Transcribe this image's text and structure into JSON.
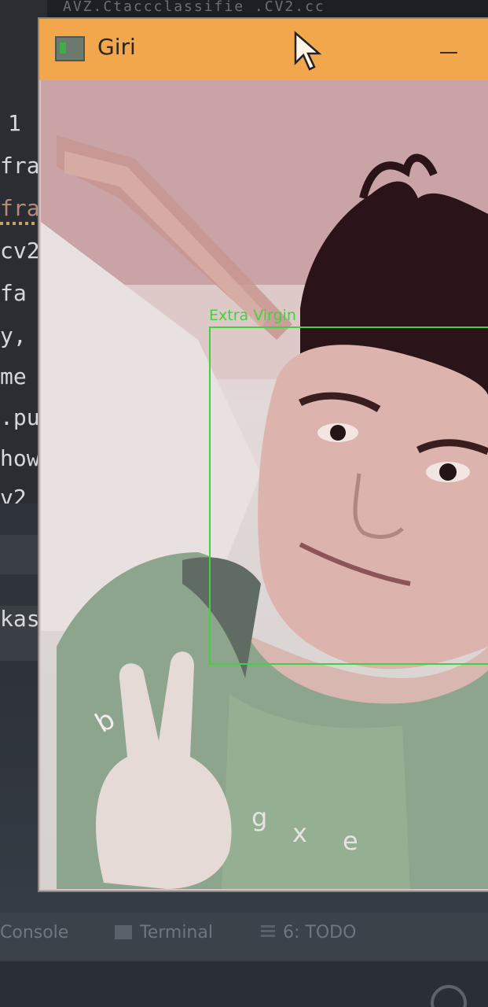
{
  "editor": {
    "top_strip": "AVZ.Ctaccclassifie  .CV2.cc",
    "code_lines": [
      "1",
      "fra",
      "fra",
      "cv2",
      " fa",
      "y,",
      "me",
      ".pu",
      "how",
      "v2",
      "kas"
    ]
  },
  "window": {
    "title": "Giri",
    "app_icon": "python-window-icon",
    "minimize_icon": "minimize-icon",
    "cursor_icon": "mouse-pointer-icon"
  },
  "camera": {
    "face_label": "Extra Virgin",
    "box_color": "#3fd23f",
    "keyboard_letters": [
      "b",
      "g",
      "x",
      "e"
    ]
  },
  "ide_toolbar": {
    "items": [
      "Console",
      "Terminal",
      "6: TODO"
    ],
    "icons": [
      "terminal-icon",
      "todo-list-icon"
    ]
  }
}
